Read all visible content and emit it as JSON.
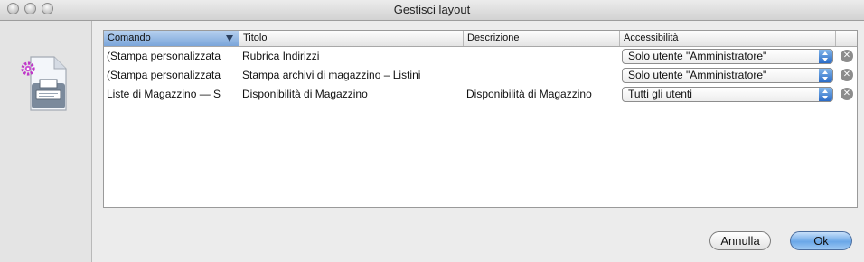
{
  "window": {
    "title": "Gestisci layout"
  },
  "table": {
    "columns": [
      "Comando",
      "Titolo",
      "Descrizione",
      "Accessibilità"
    ],
    "rows": [
      {
        "comando": "(Stampa personalizzata",
        "titolo": "Rubrica Indirizzi",
        "descrizione": "",
        "accessibilita": "Solo utente \"Amministratore\""
      },
      {
        "comando": "(Stampa personalizzata",
        "titolo": "Stampa archivi di magazzino – Listini",
        "descrizione": "",
        "accessibilita": "Solo utente \"Amministratore\""
      },
      {
        "comando": "Liste di Magazzino — S",
        "titolo": "Disponibilità di Magazzino",
        "descrizione": "Disponibilità di Magazzino",
        "accessibilita": "Tutti gli utenti"
      }
    ]
  },
  "buttons": {
    "cancel": "Annulla",
    "ok": "Ok"
  },
  "icons": {
    "sidebar": "document-print-gear-icon",
    "remove": "remove-circle-icon"
  }
}
